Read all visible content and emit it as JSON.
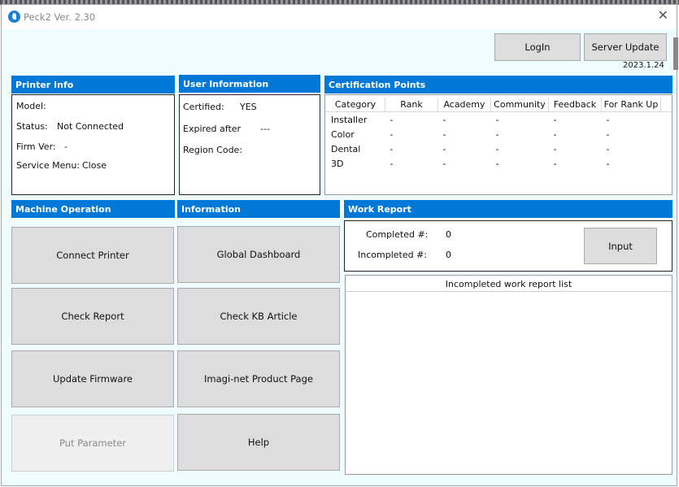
{
  "window": {
    "title": "Peck2  Ver. 2.30"
  },
  "toolbar": {
    "login_label": "LogIn",
    "server_update_label": "Server Update",
    "version_date": "2023.1.24"
  },
  "printer_info": {
    "header": "Printer Info",
    "model_label": "Model:",
    "model_value": "",
    "status_label": "Status:",
    "status_value": "Not Connected",
    "firm_label": "Firm Ver:",
    "firm_value": "-",
    "service_label": "Service Menu:",
    "service_value": "Close"
  },
  "user_info": {
    "header": "User Information",
    "certified_label": "Certified:",
    "certified_value": "YES",
    "expired_label": "Expired after",
    "expired_value": "---",
    "region_label": "Region Code:",
    "region_value": ""
  },
  "cert_points": {
    "header": "Certification Points",
    "columns": [
      "Category",
      "Rank",
      "Academy",
      "Community",
      "Feedback",
      "For Rank Up"
    ],
    "rows": [
      [
        "Installer",
        "-",
        "-",
        "-",
        "-",
        "-"
      ],
      [
        "Color",
        "-",
        "-",
        "-",
        "-",
        "-"
      ],
      [
        "Dental",
        "-",
        "-",
        "-",
        "-",
        "-"
      ],
      [
        "3D",
        "-",
        "-",
        "-",
        "-",
        "-"
      ]
    ]
  },
  "machine_op": {
    "header": "Machine Operation",
    "connect": "Connect Printer",
    "check_report": "Check Report",
    "update_firmware": "Update Firmware",
    "put_parameter": "Put Parameter"
  },
  "information": {
    "header": "Information",
    "dashboard": "Global Dashboard",
    "kb": "Check KB Article",
    "product_page": "Imagi-net Product Page",
    "help": "Help"
  },
  "work_report": {
    "header": "Work Report",
    "completed_label": "Completed #:",
    "completed_value": "0",
    "incompleted_label": "Incompleted #:",
    "incompleted_value": "0",
    "input_label": "Input",
    "list_title": "Incompleted work report list"
  }
}
